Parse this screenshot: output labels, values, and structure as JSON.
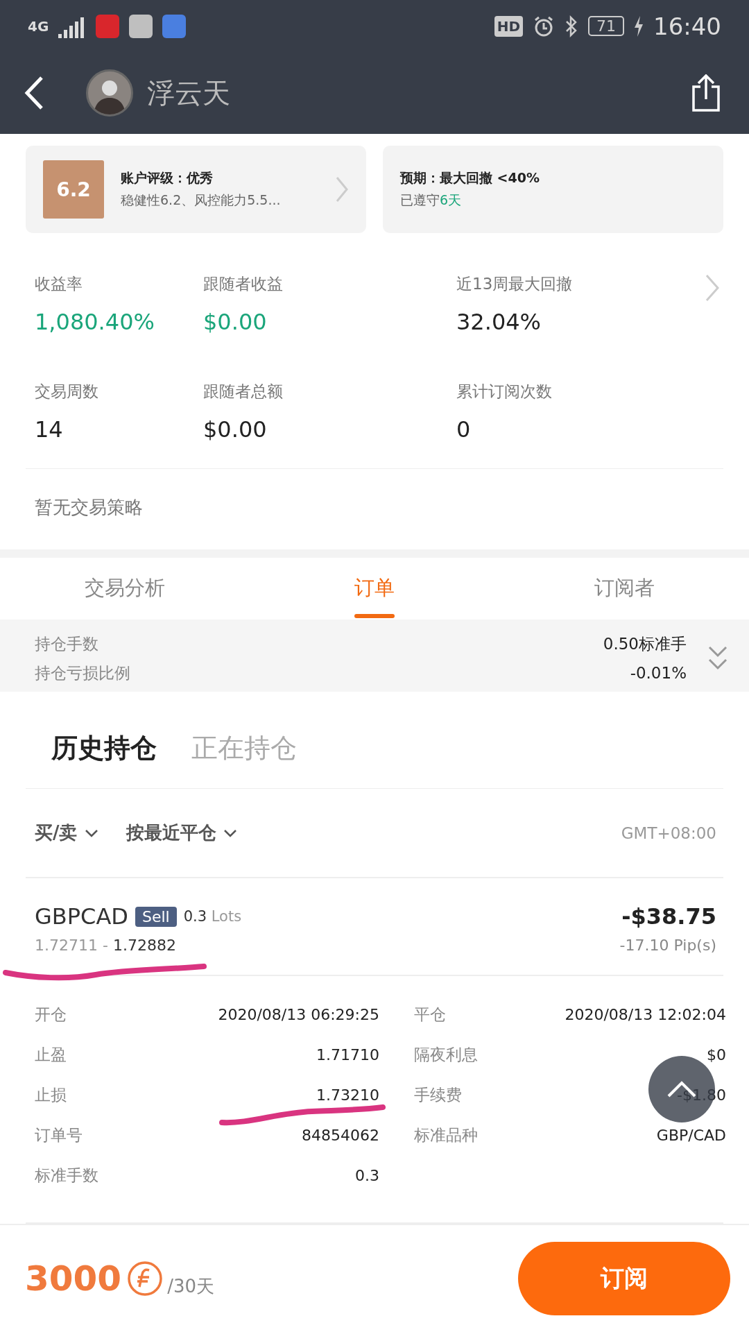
{
  "status_bar": {
    "network": "4G",
    "hd": "HD",
    "battery": "71",
    "time": "16:40"
  },
  "header": {
    "name": "浮云天"
  },
  "rating_card": {
    "score": "6.2",
    "title": "账户评级：优秀",
    "subtitle": "稳健性6.2、风控能力5.5..."
  },
  "expectation_card": {
    "title": "预期：最大回撤 <40%",
    "prefix": "已遵守",
    "highlight": "6天"
  },
  "stats": [
    {
      "label": "收益率",
      "value": "1,080.40%",
      "color": "#1aa57a"
    },
    {
      "label": "跟随者收益",
      "value": "$0.00",
      "color": "#1aa57a"
    },
    {
      "label": "近13周最大回撤",
      "value": "32.04%",
      "color": "#222222",
      "arrow": true
    },
    {
      "label": "交易周数",
      "value": "14",
      "color": "#222222"
    },
    {
      "label": "跟随者总额",
      "value": "$0.00",
      "color": "#222222"
    },
    {
      "label": "累计订阅次数",
      "value": "0",
      "color": "#222222"
    }
  ],
  "strategy": "暂无交易策略",
  "tabs": [
    {
      "label": "交易分析",
      "selected": false
    },
    {
      "label": "订单",
      "selected": true
    },
    {
      "label": "订阅者",
      "selected": false
    }
  ],
  "summary": [
    {
      "label": "持仓手数",
      "value": "0.50标准手"
    },
    {
      "label": "持仓亏损比例",
      "value": "-0.01%"
    }
  ],
  "subtabs": [
    {
      "label": "历史持仓",
      "selected": true
    },
    {
      "label": "正在持仓",
      "selected": false
    }
  ],
  "filters": [
    {
      "label": "买/卖"
    },
    {
      "label": "按最近平仓"
    }
  ],
  "timezone": "GMT+08:00",
  "order": {
    "symbol": "GBPCAD",
    "side": "Sell",
    "lots": "0.3",
    "lots_unit": "Lots",
    "open_price": "1.72711",
    "separator": "-",
    "close_price": "1.72882",
    "profit": "-$38.75",
    "pips": "-17.10 Pip(s)"
  },
  "details": [
    {
      "label": "开仓",
      "value": "2020/08/13 06:29:25"
    },
    {
      "label": "平仓",
      "value": "2020/08/13 12:02:04"
    },
    {
      "label": "止盈",
      "value": "1.71710"
    },
    {
      "label": "隔夜利息",
      "value": "$0"
    },
    {
      "label": "止损",
      "value": "1.73210"
    },
    {
      "label": "手续费",
      "value": "-$1.80"
    },
    {
      "label": "订单号",
      "value": "84854062"
    },
    {
      "label": "标准品种",
      "value": "GBP/CAD"
    },
    {
      "label": "标准手数",
      "value": "0.3"
    }
  ],
  "footer": {
    "price": "3000",
    "period": "/30天",
    "button": "订阅"
  }
}
